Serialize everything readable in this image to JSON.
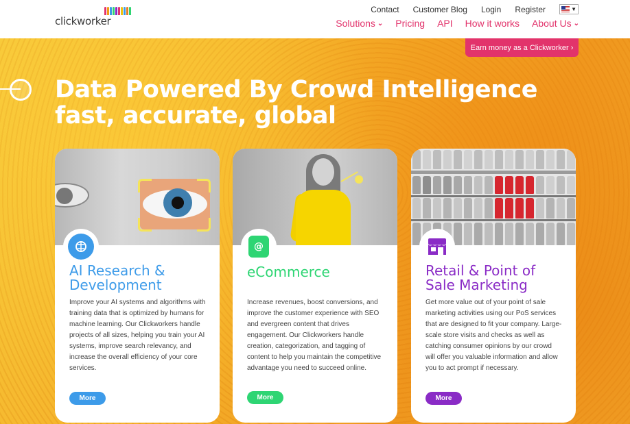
{
  "logo": {
    "text": "clickworker"
  },
  "top_links": [
    "Contact",
    "Customer Blog",
    "Login",
    "Register"
  ],
  "language": {
    "icon": "us-flag-icon"
  },
  "nav": [
    {
      "label": "Solutions",
      "has_dropdown": true
    },
    {
      "label": "Pricing",
      "has_dropdown": false
    },
    {
      "label": "API",
      "has_dropdown": false
    },
    {
      "label": "How it works",
      "has_dropdown": false
    },
    {
      "label": "About Us",
      "has_dropdown": true
    }
  ],
  "earn_button": {
    "label": "Earn money as a Clickworker",
    "icon": "chevron-right-icon"
  },
  "hero": {
    "title_line1": "Data Powered By Crowd Intelligence",
    "title_line2": "fast, accurate, global"
  },
  "colors": {
    "accent": "#e2336b",
    "blue": "#3d9be9",
    "green": "#2ed573",
    "purple": "#8a2bc6"
  },
  "cards": [
    {
      "title_line1": "AI Research &",
      "title_line2": "Development",
      "text": "Improve your AI systems and algorithms with training data that is optimized by humans for machine learning. Our Clickworkers handle projects of all sizes, helping you train your AI systems, improve search relevancy, and increase the overall efficiency of your core services.",
      "button": "More",
      "icon": "brain-icon"
    },
    {
      "title_line1": "eCommerce",
      "title_line2": "",
      "text": "Increase revenues, boost conversions, and improve the customer experience with SEO and evergreen content that drives engagement. Our Clickworkers handle creation, categorization, and tagging of content to help you maintain the competitive advantage you need to succeed online.",
      "button": "More",
      "icon": "shopping-bag-icon"
    },
    {
      "title_line1": "Retail & Point of",
      "title_line2": "Sale Marketing",
      "text": "Get more value out of your point of sale marketing activities using our PoS services that are designed to fit your company. Large-scale store visits and checks as well as catching consumer opinions by our crowd will offer you valuable information and allow you to act prompt if necessary.",
      "button": "More",
      "icon": "store-icon"
    }
  ]
}
